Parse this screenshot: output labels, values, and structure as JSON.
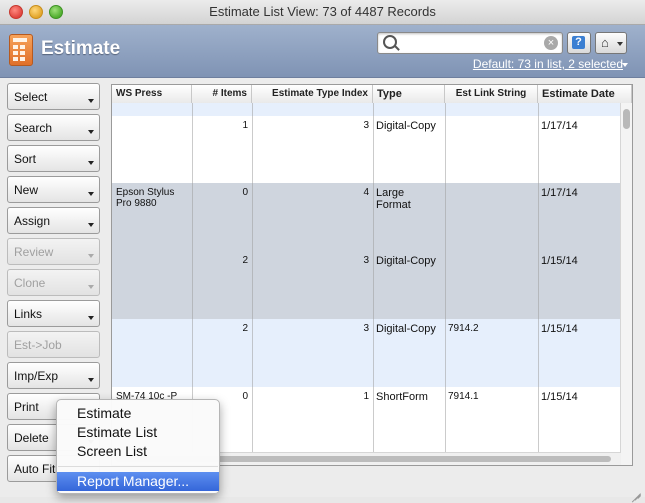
{
  "window": {
    "title": "Estimate List View: 73 of 4487 Records"
  },
  "header": {
    "title": "Estimate",
    "search_value": "",
    "found_set": "Default: 73 in list, 2 selected",
    "help_label": "?",
    "home_label": "⌂"
  },
  "sidebar": {
    "buttons": [
      {
        "label": "Select",
        "enabled": true,
        "dropdown": true
      },
      {
        "label": "Search",
        "enabled": true,
        "dropdown": true
      },
      {
        "label": "Sort",
        "enabled": true,
        "dropdown": true
      },
      {
        "label": "New",
        "enabled": true,
        "dropdown": true
      },
      {
        "label": "Assign",
        "enabled": true,
        "dropdown": true
      },
      {
        "label": "Review",
        "enabled": false,
        "dropdown": true
      },
      {
        "label": "Clone",
        "enabled": false,
        "dropdown": true
      },
      {
        "label": "Links",
        "enabled": true,
        "dropdown": true
      },
      {
        "label": "Est->Job",
        "enabled": false,
        "dropdown": false
      },
      {
        "label": "Imp/Exp",
        "enabled": true,
        "dropdown": true
      },
      {
        "label": "Print",
        "enabled": true,
        "dropdown": true
      },
      {
        "label": "Delete",
        "enabled": true,
        "dropdown": true
      },
      {
        "label": "Auto Fit",
        "enabled": true,
        "dropdown": true
      }
    ]
  },
  "table": {
    "columns": [
      "WS Press",
      "# Items",
      "Estimate Type Index",
      "Type",
      "Est Link String",
      "Estimate Date"
    ],
    "rows": [
      {
        "ws_press": "",
        "items": "",
        "type_index": "",
        "type": "",
        "link": "",
        "date": "",
        "selected": false
      },
      {
        "ws_press": "",
        "items": "1",
        "type_index": "3",
        "type": "Digital-Copy",
        "link": "",
        "date": "1/17/14",
        "selected": false
      },
      {
        "ws_press": "Epson Stylus Pro 9880",
        "items": "0",
        "type_index": "4",
        "type": "Large Format",
        "link": "",
        "date": "1/17/14",
        "selected": true
      },
      {
        "ws_press": "",
        "items": "2",
        "type_index": "3",
        "type": "Digital-Copy",
        "link": "",
        "date": "1/15/14",
        "selected": true
      },
      {
        "ws_press": "",
        "items": "2",
        "type_index": "3",
        "type": "Digital-Copy",
        "link": "7914.2",
        "date": "1/15/14",
        "selected": false
      },
      {
        "ws_press": "SM-74 10c -P",
        "items": "0",
        "type_index": "1",
        "type": "ShortForm",
        "link": "7914.1",
        "date": "1/15/14",
        "selected": false
      }
    ]
  },
  "popup_menu": {
    "items": [
      "Estimate",
      "Estimate List",
      "Screen List",
      "Report Manager..."
    ],
    "highlighted": "Report Manager..."
  },
  "colors": {
    "header_band": "#8a9dbd",
    "selected_row": "#cfd5de",
    "alt_row": "#e6effc",
    "menu_highlight": "#3f74e0"
  }
}
